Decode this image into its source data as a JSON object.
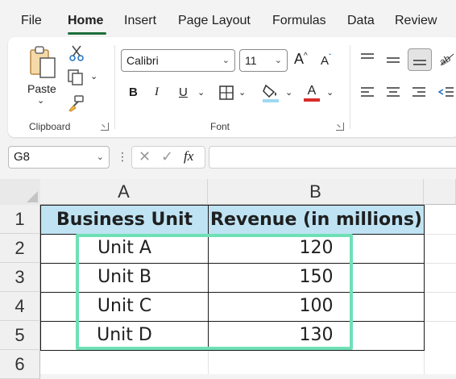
{
  "menu": {
    "tabs": [
      "File",
      "Home",
      "Insert",
      "Page Layout",
      "Formulas",
      "Data",
      "Review"
    ],
    "active": "Home"
  },
  "ribbon": {
    "clipboard": {
      "paste_label": "Paste",
      "group_label": "Clipboard"
    },
    "font": {
      "font_name": "Calibri",
      "font_size": "11",
      "group_label": "Font",
      "bold": "B",
      "italic": "I",
      "underline": "U",
      "grow": "A",
      "shrink": "A",
      "font_color_letter": "A",
      "font_color": "#d92b2b",
      "fill_color": "#9fd8f0"
    }
  },
  "formula_bar": {
    "name_box": "G8",
    "fx": "fx",
    "formula": ""
  },
  "sheet": {
    "columns": [
      "A",
      "B"
    ],
    "rows": [
      "1",
      "2",
      "3",
      "4",
      "5",
      "6"
    ],
    "header": [
      "Business Unit",
      "Revenue (in millions)"
    ],
    "data": [
      [
        "Unit A",
        "120"
      ],
      [
        "Unit B",
        "150"
      ],
      [
        "Unit C",
        "100"
      ],
      [
        "Unit D",
        "130"
      ]
    ],
    "header_fill": "#bfe3f3",
    "highlight_color": "#6fe0b5"
  }
}
